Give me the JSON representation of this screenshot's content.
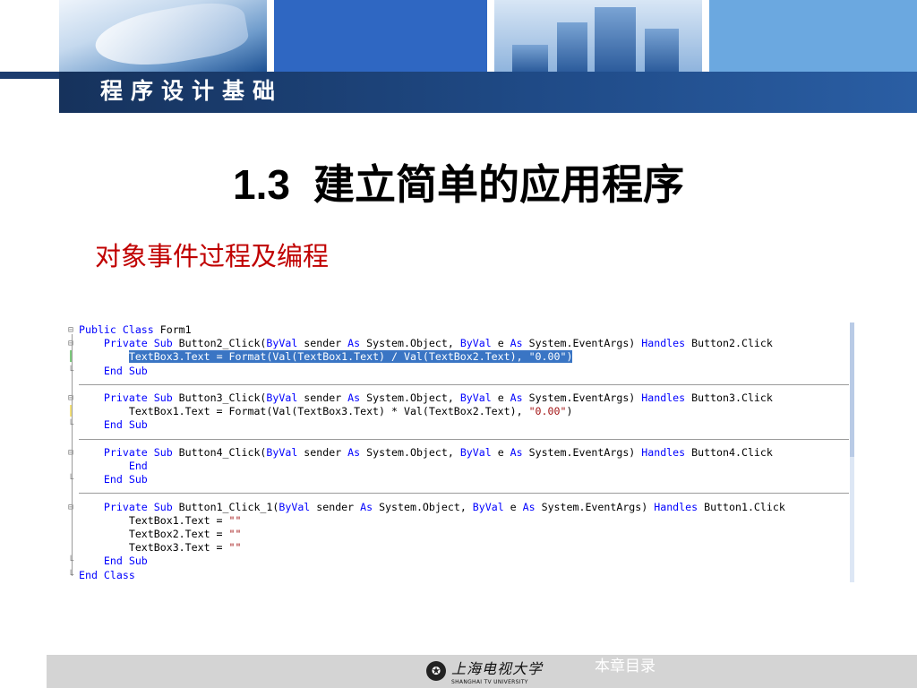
{
  "header": {
    "course_title": "程序设计基础"
  },
  "slide": {
    "number": "1.3",
    "title": "建立简单的应用程序",
    "subtitle": "对象事件过程及编程"
  },
  "code": {
    "lines": [
      [
        {
          "t": "Public Class",
          "c": "kw"
        },
        {
          "t": " Form1"
        }
      ],
      [
        {
          "t": "    "
        },
        {
          "t": "Private Sub",
          "c": "kw"
        },
        {
          "t": " Button2_Click("
        },
        {
          "t": "ByVal",
          "c": "kw"
        },
        {
          "t": " sender "
        },
        {
          "t": "As",
          "c": "kw"
        },
        {
          "t": " System.Object, "
        },
        {
          "t": "ByVal",
          "c": "kw"
        },
        {
          "t": " e "
        },
        {
          "t": "As",
          "c": "kw"
        },
        {
          "t": " System.EventArgs) "
        },
        {
          "t": "Handles",
          "c": "kw"
        },
        {
          "t": " Button2.Click"
        }
      ],
      [
        {
          "t": "        "
        },
        {
          "t": "TextBox3.Text = Format(Val(TextBox1.Text) / Val(TextBox2.Text), \"0.00\")",
          "c": "hl"
        }
      ],
      [
        {
          "t": "    "
        },
        {
          "t": "End Sub",
          "c": "kw"
        }
      ],
      [],
      [
        {
          "t": "    "
        },
        {
          "t": "Private Sub",
          "c": "kw"
        },
        {
          "t": " Button3_Click("
        },
        {
          "t": "ByVal",
          "c": "kw"
        },
        {
          "t": " sender "
        },
        {
          "t": "As",
          "c": "kw"
        },
        {
          "t": " System.Object, "
        },
        {
          "t": "ByVal",
          "c": "kw"
        },
        {
          "t": " e "
        },
        {
          "t": "As",
          "c": "kw"
        },
        {
          "t": " System.EventArgs) "
        },
        {
          "t": "Handles",
          "c": "kw"
        },
        {
          "t": " Button3.Click"
        }
      ],
      [
        {
          "t": "        TextBox1.Text = Format(Val(TextBox3.Text) * Val(TextBox2.Text), "
        },
        {
          "t": "\"0.00\"",
          "c": "str"
        },
        {
          "t": ")"
        }
      ],
      [
        {
          "t": "    "
        },
        {
          "t": "End Sub",
          "c": "kw"
        }
      ],
      [],
      [
        {
          "t": "    "
        },
        {
          "t": "Private Sub",
          "c": "kw"
        },
        {
          "t": " Button4_Click("
        },
        {
          "t": "ByVal",
          "c": "kw"
        },
        {
          "t": " sender "
        },
        {
          "t": "As",
          "c": "kw"
        },
        {
          "t": " System.Object, "
        },
        {
          "t": "ByVal",
          "c": "kw"
        },
        {
          "t": " e "
        },
        {
          "t": "As",
          "c": "kw"
        },
        {
          "t": " System.EventArgs) "
        },
        {
          "t": "Handles",
          "c": "kw"
        },
        {
          "t": " Button4.Click"
        }
      ],
      [
        {
          "t": "        "
        },
        {
          "t": "End",
          "c": "kw"
        }
      ],
      [
        {
          "t": "    "
        },
        {
          "t": "End Sub",
          "c": "kw"
        }
      ],
      [],
      [
        {
          "t": "    "
        },
        {
          "t": "Private Sub",
          "c": "kw"
        },
        {
          "t": " Button1_Click_1("
        },
        {
          "t": "ByVal",
          "c": "kw"
        },
        {
          "t": " sender "
        },
        {
          "t": "As",
          "c": "kw"
        },
        {
          "t": " System.Object, "
        },
        {
          "t": "ByVal",
          "c": "kw"
        },
        {
          "t": " e "
        },
        {
          "t": "As",
          "c": "kw"
        },
        {
          "t": " System.EventArgs) "
        },
        {
          "t": "Handles",
          "c": "kw"
        },
        {
          "t": " Button1.Click"
        }
      ],
      [
        {
          "t": "        TextBox1.Text = "
        },
        {
          "t": "\"\"",
          "c": "str"
        }
      ],
      [
        {
          "t": "        TextBox2.Text = "
        },
        {
          "t": "\"\"",
          "c": "str"
        }
      ],
      [
        {
          "t": "        TextBox3.Text = "
        },
        {
          "t": "\"\"",
          "c": "str"
        }
      ],
      [
        {
          "t": "    "
        },
        {
          "t": "End Sub",
          "c": "kw"
        }
      ],
      [
        {
          "t": "End Class",
          "c": "kw"
        }
      ]
    ]
  },
  "footer": {
    "logo_cn": "上海电视大学",
    "logo_en": "SHANGHAI TV UNIVERSITY",
    "toc_link": "本章目录"
  },
  "colors": {
    "keyword": "#0000ff",
    "string": "#a31515",
    "highlight": "#3a75c4",
    "subtitle": "#c00000",
    "banner": "#1f4a86"
  }
}
